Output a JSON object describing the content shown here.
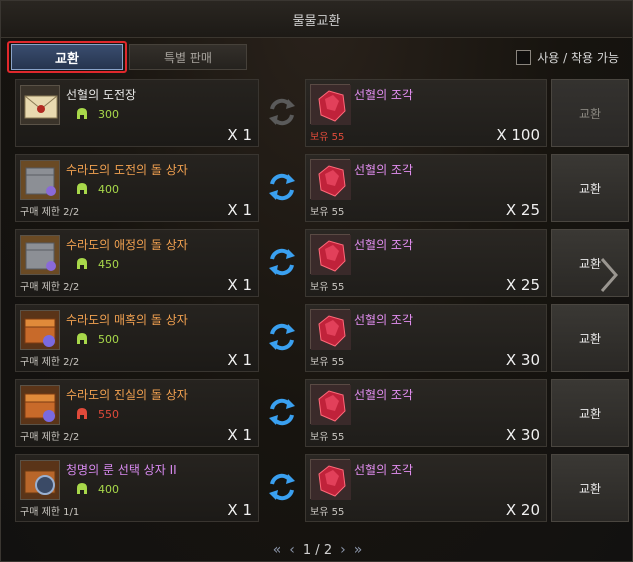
{
  "window": {
    "title": "물물교환"
  },
  "tabs": [
    {
      "label": "교환",
      "active": true
    },
    {
      "label": "특별 판매",
      "active": false
    }
  ],
  "toggle": {
    "label": "사용 / 착용 가능",
    "checked": false
  },
  "rows": [
    {
      "name": "선혈의 도전장",
      "name_color": "#e8e8e8",
      "price": "300",
      "price_color": "#a8d84a",
      "limit": "",
      "qty": "X 1",
      "target_name": "선혈의 조각",
      "owned": "보유 55",
      "owned_red": true,
      "target_qty": "X 100",
      "button": "교환",
      "enabled": false,
      "icon": "envelope-icon"
    },
    {
      "name": "수라도의 도전의 돌 상자",
      "name_color": "#f0a050",
      "price": "400",
      "price_color": "#a8d84a",
      "limit": "구매 제한 2/2",
      "qty": "X 1",
      "target_name": "선혈의 조각",
      "owned": "보유 55",
      "owned_red": false,
      "target_qty": "X 25",
      "button": "교환",
      "enabled": true,
      "icon": "stone-box-icon"
    },
    {
      "name": "수라도의 애정의 돌 상자",
      "name_color": "#f0a050",
      "price": "450",
      "price_color": "#a8d84a",
      "limit": "구매 제한 2/2",
      "qty": "X 1",
      "target_name": "선혈의 조각",
      "owned": "보유 55",
      "owned_red": false,
      "target_qty": "X 25",
      "button": "교환",
      "enabled": true,
      "icon": "stone-box-icon"
    },
    {
      "name": "수라도의 매혹의 돌 상자",
      "name_color": "#f0a050",
      "price": "500",
      "price_color": "#a8d84a",
      "limit": "구매 제한 2/2",
      "qty": "X 1",
      "target_name": "선혈의 조각",
      "owned": "보유 55",
      "owned_red": false,
      "target_qty": "X 30",
      "button": "교환",
      "enabled": true,
      "icon": "chest-icon"
    },
    {
      "name": "수라도의 진실의 돌 상자",
      "name_color": "#f0a050",
      "price": "550",
      "price_color": "#e04a3a",
      "limit": "구매 제한 2/2",
      "qty": "X 1",
      "target_name": "선혈의 조각",
      "owned": "보유 55",
      "owned_red": false,
      "target_qty": "X 30",
      "button": "교환",
      "enabled": true,
      "icon": "chest-icon"
    },
    {
      "name": "청명의 룬 선택 상자 II",
      "name_color": "#d88af0",
      "price": "400",
      "price_color": "#a8d84a",
      "limit": "구매 제한 1/1",
      "qty": "X 1",
      "target_name": "선혈의 조각",
      "owned": "보유 55",
      "owned_red": false,
      "target_qty": "X 20",
      "button": "교환",
      "enabled": true,
      "icon": "rune-box-icon"
    }
  ],
  "pager": {
    "first": "«",
    "prev": "‹",
    "text": "1 / 2",
    "next": "›",
    "last": "»"
  }
}
